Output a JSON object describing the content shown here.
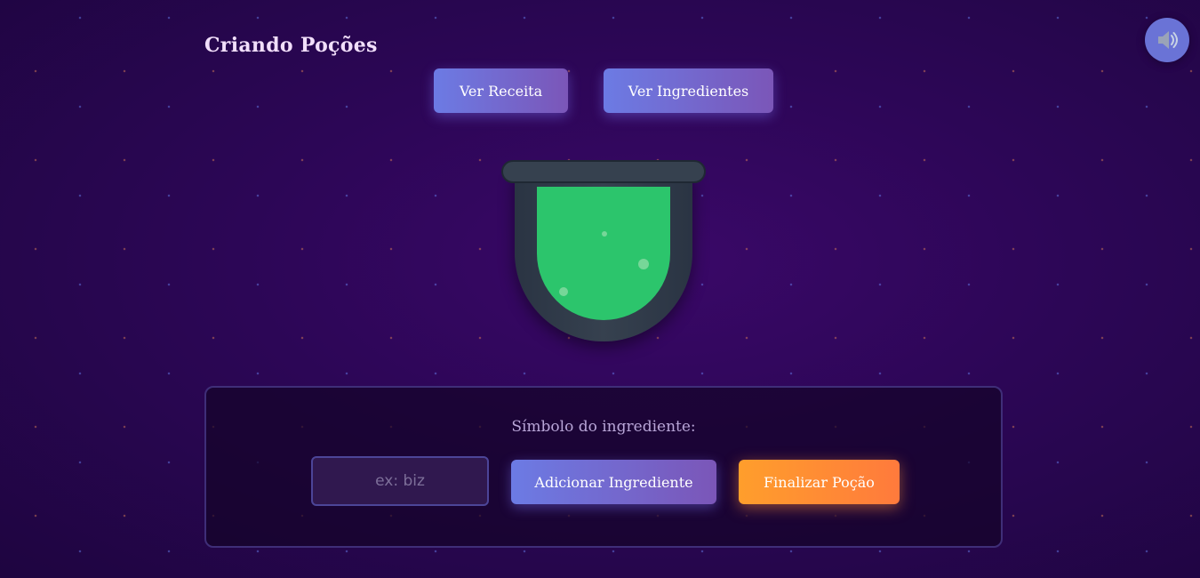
{
  "page": {
    "title": "Criando Poções"
  },
  "sound": {
    "icon": "speaker-icon"
  },
  "toolbar": {
    "recipe_label": "Ver Receita",
    "ingredients_label": "Ver Ingredientes"
  },
  "cauldron": {
    "liquid_color": "#2cc56c"
  },
  "form": {
    "label": "Símbolo do ingrediente:",
    "input_value": "",
    "input_placeholder": "ex: biz",
    "add_label": "Adicionar Ingrediente",
    "finish_label": "Finalizar Poção"
  },
  "colors": {
    "primary_gradient_start": "#6c7be4",
    "primary_gradient_end": "#7b56b8",
    "accent_orange": "#ff8a34",
    "background": "#2c0656"
  }
}
